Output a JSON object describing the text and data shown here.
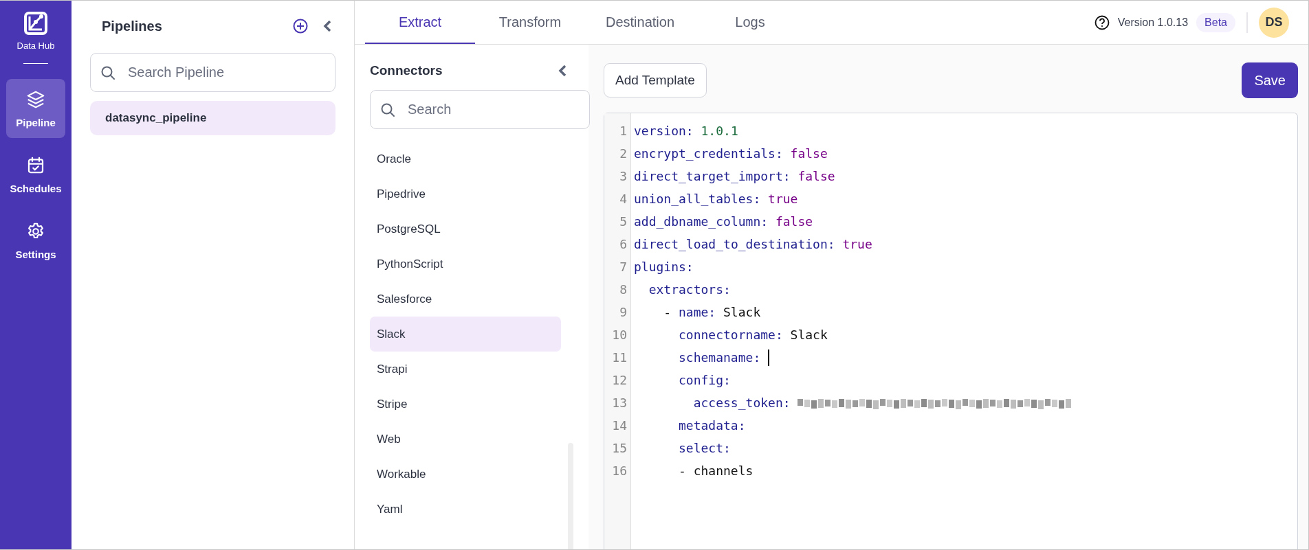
{
  "nav": {
    "logo_label": "Data Hub",
    "items": [
      {
        "label": "Pipeline",
        "selected": true
      },
      {
        "label": "Schedules",
        "selected": false
      },
      {
        "label": "Settings",
        "selected": false
      }
    ]
  },
  "pipelines": {
    "title": "Pipelines",
    "search": {
      "placeholder": "Search Pipeline"
    },
    "items": [
      {
        "label": "datasync_pipeline",
        "selected": true
      }
    ]
  },
  "tabs": [
    {
      "label": "Extract",
      "selected": true
    },
    {
      "label": "Transform",
      "selected": false
    },
    {
      "label": "Destination",
      "selected": false
    },
    {
      "label": "Logs",
      "selected": false
    }
  ],
  "header": {
    "version": "Version 1.0.13",
    "badge": "Beta",
    "avatar": "DS"
  },
  "connectors": {
    "title": "Connectors",
    "search": {
      "placeholder": "Search"
    },
    "items": [
      {
        "label": "Oracle",
        "selected": false
      },
      {
        "label": "Pipedrive",
        "selected": false
      },
      {
        "label": "PostgreSQL",
        "selected": false
      },
      {
        "label": "PythonScript",
        "selected": false
      },
      {
        "label": "Salesforce",
        "selected": false
      },
      {
        "label": "Slack",
        "selected": true
      },
      {
        "label": "Strapi",
        "selected": false
      },
      {
        "label": "Stripe",
        "selected": false
      },
      {
        "label": "Web",
        "selected": false
      },
      {
        "label": "Workable",
        "selected": false
      },
      {
        "label": "Yaml",
        "selected": false
      }
    ]
  },
  "toolbar": {
    "add_template": "Add Template",
    "save": "Save"
  },
  "editor": {
    "lines": [
      {
        "number": "1",
        "key": "version:",
        "value": "1.0.1",
        "kind": "number"
      },
      {
        "number": "2",
        "key": "encrypt_credentials:",
        "value": "false",
        "kind": "bool"
      },
      {
        "number": "3",
        "key": "direct_target_import:",
        "value": "false",
        "kind": "bool"
      },
      {
        "number": "4",
        "key": "union_all_tables:",
        "value": "true",
        "kind": "bool"
      },
      {
        "number": "5",
        "key": "add_dbname_column:",
        "value": "false",
        "kind": "bool"
      },
      {
        "number": "6",
        "key": "direct_load_to_destination:",
        "value": "true",
        "kind": "bool"
      },
      {
        "number": "7",
        "key": "plugins:",
        "children": [
          {
            "number": "8",
            "key": "extractors:",
            "children": [
              {
                "number": "9",
                "dash": "-",
                "key": "name:",
                "value": "Slack",
                "kind": "string",
                "children": [
                  {
                    "number": "10",
                    "key": "connectorname:",
                    "value": "Slack",
                    "kind": "string"
                  },
                  {
                    "number": "11",
                    "key": "schemaname:",
                    "cursor": true
                  },
                  {
                    "number": "12",
                    "key": "config:",
                    "children": [
                      {
                        "number": "13",
                        "key": "access_token:",
                        "kind": "redacted"
                      }
                    ]
                  },
                  {
                    "number": "14",
                    "key": "metadata:"
                  },
                  {
                    "number": "15",
                    "key": "select:"
                  },
                  {
                    "number": "16",
                    "dash": "-",
                    "value": "channels",
                    "kind": "string"
                  }
                ]
              }
            ]
          }
        ]
      }
    ]
  }
}
